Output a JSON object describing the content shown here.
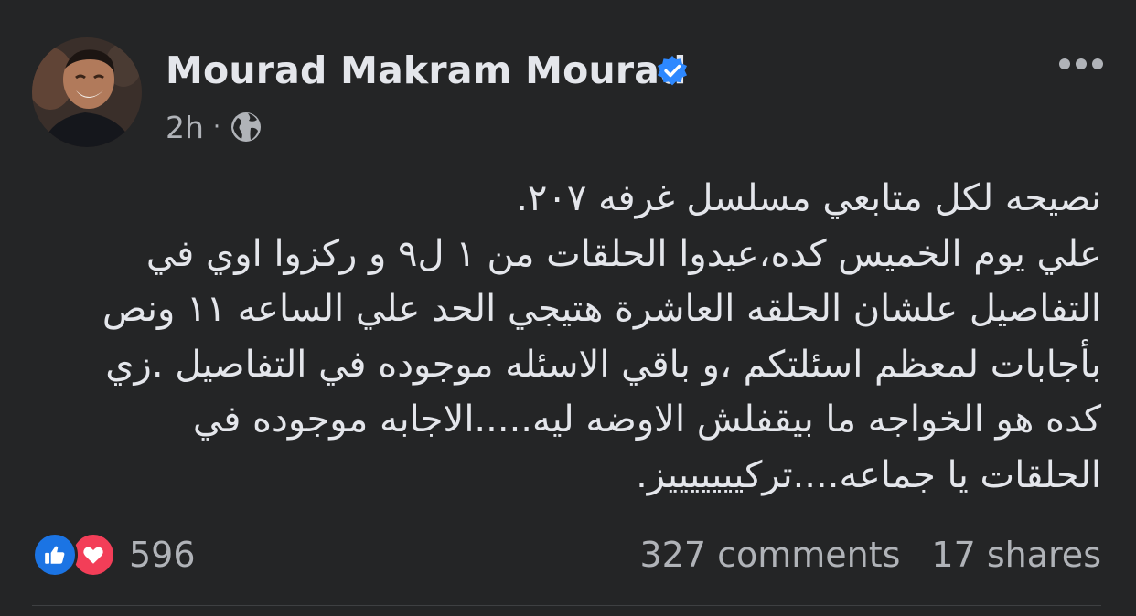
{
  "post": {
    "author": {
      "name": "Mourad Makram Mourad",
      "avatar_icon": "profile-photo",
      "verified_icon": "verified-badge-icon"
    },
    "meta": {
      "time": "2h",
      "separator": "·",
      "audience_icon": "globe-icon"
    },
    "more_icon": "more-options-icon",
    "text_lines": [
      "نصيحه لكل متابعي مسلسل غرفه ٢٠٧.",
      "علي يوم الخميس كده،عيدوا الحلقات من ١ ل٩ و ركزوا اوي في",
      "التفاصيل علشان الحلقه العاشرة هتيجي الحد علي الساعه ١١ ونص",
      "بأجابات لمعظم اسئلتكم ،و باقي الاسئله موجوده في التفاصيل .زي",
      "كده هو الخواجه ما بيقفلش الاوضه ليه.....الاجابه موجوده في",
      "الحلقات يا جماعه....تركيييييييز."
    ],
    "reactions": {
      "count": "596",
      "types": [
        "like",
        "love"
      ]
    },
    "stats": {
      "comments": "327 comments",
      "shares": "17 shares"
    }
  },
  "colors": {
    "background": "#242526",
    "primary_text": "#e4e6eb",
    "secondary_text": "#b0b3b8",
    "like_blue": "#1b74e4",
    "love_red": "#f33e58",
    "verified_blue": "#2d88ff"
  }
}
